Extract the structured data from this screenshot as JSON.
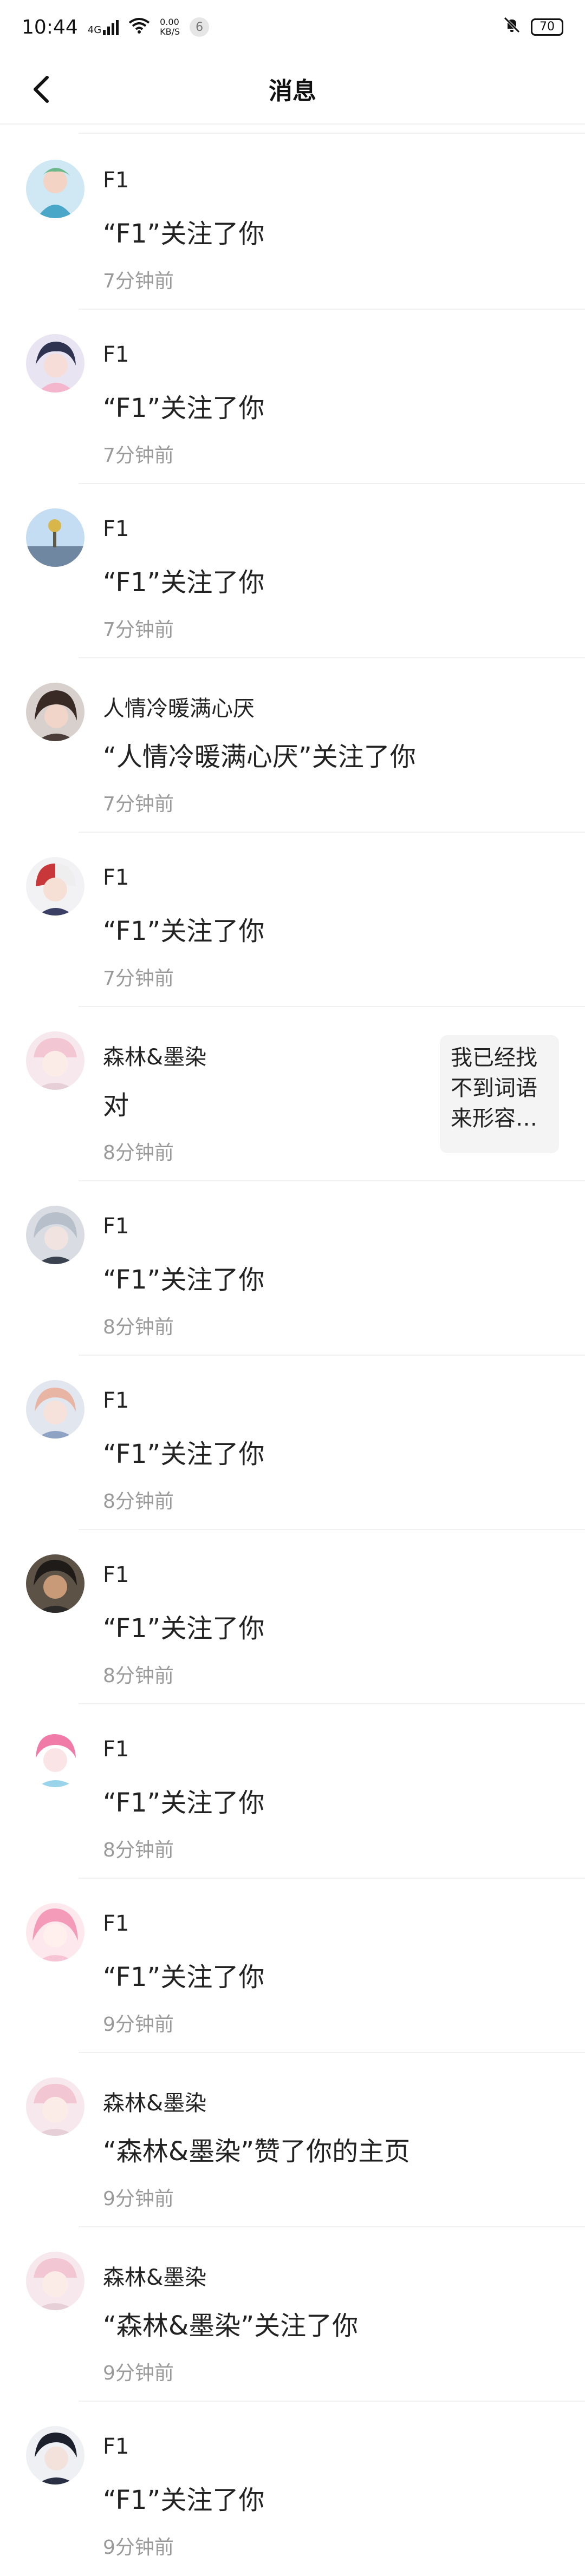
{
  "status_bar": {
    "time": "10:44",
    "signal": "4G",
    "speed_value": "0.00",
    "speed_unit": "KB/S",
    "notification_count": "6",
    "battery": "70"
  },
  "header": {
    "title": "消息"
  },
  "notifications": [
    {
      "name": "F1",
      "message": "“F1”关注了你",
      "time": "7分钟前"
    },
    {
      "name": "F1",
      "message": "“F1”关注了你",
      "time": "7分钟前"
    },
    {
      "name": "F1",
      "message": "“F1”关注了你",
      "time": "7分钟前"
    },
    {
      "name": "人情冷暖满心厌",
      "message": "“人情冷暖满心厌”关注了你",
      "time": "7分钟前"
    },
    {
      "name": "F1",
      "message": "“F1”关注了你",
      "time": "7分钟前"
    },
    {
      "name": "森林&墨染",
      "message": "对",
      "time": "8分钟前",
      "quote": "我已经找不到词语来形容…"
    },
    {
      "name": "F1",
      "message": "“F1”关注了你",
      "time": "8分钟前"
    },
    {
      "name": "F1",
      "message": "“F1”关注了你",
      "time": "8分钟前"
    },
    {
      "name": "F1",
      "message": "“F1”关注了你",
      "time": "8分钟前"
    },
    {
      "name": "F1",
      "message": "“F1”关注了你",
      "time": "8分钟前"
    },
    {
      "name": "F1",
      "message": "“F1”关注了你",
      "time": "9分钟前"
    },
    {
      "name": "森林&墨染",
      "message": "“森林&墨染”赞了你的主页",
      "time": "9分钟前"
    },
    {
      "name": "森林&墨染",
      "message": "“森林&墨染”关注了你",
      "time": "9分钟前"
    },
    {
      "name": "F1",
      "message": "“F1”关注了你",
      "time": "9分钟前"
    }
  ],
  "colors": {
    "background": "#ffffff",
    "secondary_text": "#9a9a9a",
    "divider": "#f0f0f0"
  }
}
